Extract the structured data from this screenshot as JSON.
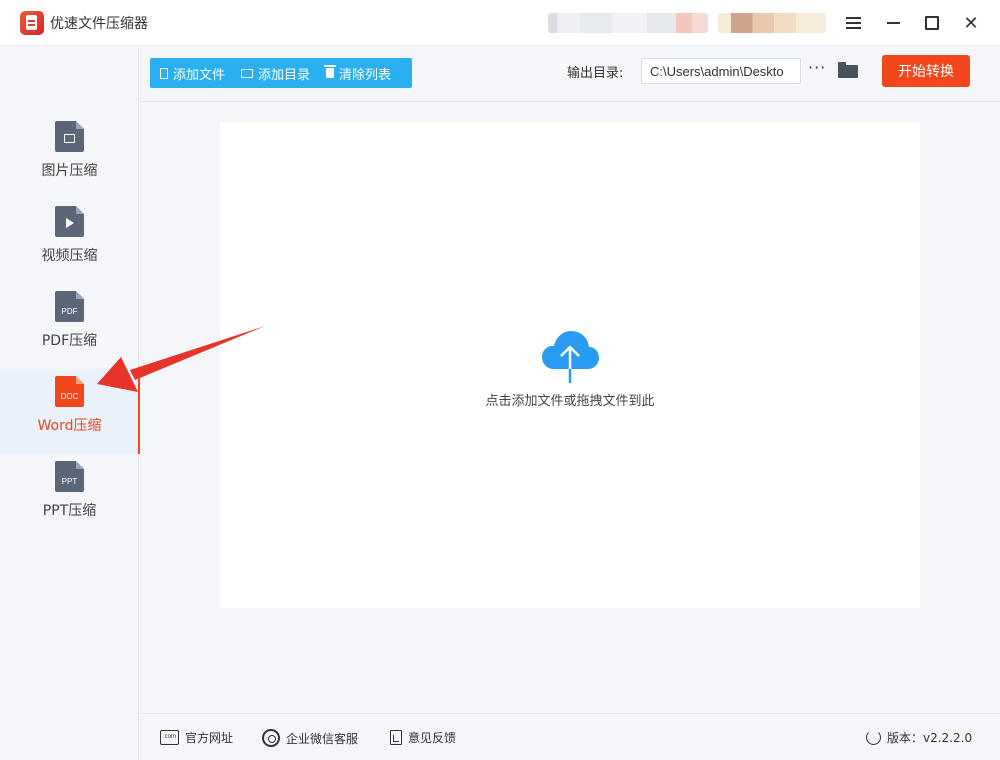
{
  "app": {
    "title": "优速文件压缩器"
  },
  "sidebar": {
    "items": [
      {
        "label": "图片压缩",
        "icon": "image-file-icon",
        "active": false
      },
      {
        "label": "视频压缩",
        "icon": "video-file-icon",
        "active": false
      },
      {
        "label": "PDF压缩",
        "icon": "pdf-file-icon",
        "icon_text": "PDF",
        "active": false
      },
      {
        "label": "Word压缩",
        "icon": "doc-file-icon",
        "icon_text": "DOC",
        "active": true
      },
      {
        "label": "PPT压缩",
        "icon": "ppt-file-icon",
        "icon_text": "PPT",
        "active": false
      }
    ]
  },
  "toolbar": {
    "add_file": "添加文件",
    "add_folder": "添加目录",
    "clear_list": "清除列表",
    "output_label": "输出目录:",
    "output_path": "C:\\Users\\admin\\Deskto",
    "more": "···",
    "start": "开始转换"
  },
  "dropzone": {
    "text": "点击添加文件或拖拽文件到此"
  },
  "footer": {
    "website": "官方网址",
    "website_icon_text": ".com",
    "wechat": "企业微信客服",
    "feedback": "意见反馈",
    "version": "版本：v2.2.2.0"
  },
  "colors": {
    "accent": "#f2461d",
    "toolbar_blue": "#2ab0f0",
    "cloud_blue": "#2a9bf2",
    "annotation_arrow": "#e8332a"
  }
}
